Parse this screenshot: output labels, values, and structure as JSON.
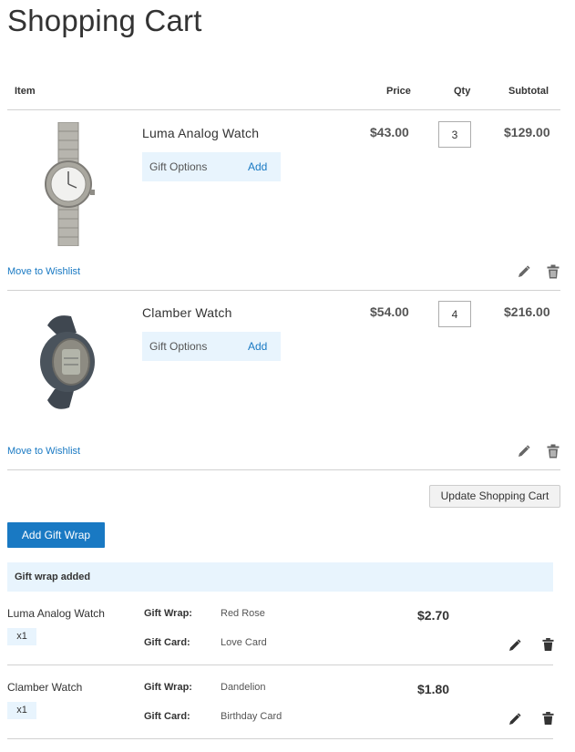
{
  "page": {
    "title": "Shopping Cart"
  },
  "cart": {
    "headers": {
      "item": "Item",
      "price": "Price",
      "qty": "Qty",
      "subtotal": "Subtotal"
    },
    "items": [
      {
        "name": "Luma Analog Watch",
        "gift_options_label": "Gift Options",
        "gift_add_label": "Add",
        "price": "$43.00",
        "qty": "3",
        "subtotal": "$129.00",
        "wishlist_label": "Move to Wishlist"
      },
      {
        "name": "Clamber Watch",
        "gift_options_label": "Gift Options",
        "gift_add_label": "Add",
        "price": "$54.00",
        "qty": "4",
        "subtotal": "$216.00",
        "wishlist_label": "Move to Wishlist"
      }
    ],
    "update_button": "Update Shopping Cart"
  },
  "gift_wrap": {
    "add_button": "Add Gift Wrap",
    "banner": "Gift wrap added",
    "rows": [
      {
        "product": "Luma Analog Watch",
        "qty": "x1",
        "wrap_label": "Gift Wrap:",
        "wrap_value": "Red Rose",
        "card_label": "Gift Card:",
        "card_value": "Love Card",
        "price": "$2.70"
      },
      {
        "product": "Clamber Watch",
        "qty": "x1",
        "wrap_label": "Gift Wrap:",
        "wrap_value": "Dandelion",
        "card_label": "Gift Card:",
        "card_value": "Birthday Card",
        "price": "$1.80"
      }
    ]
  },
  "icons": {
    "edit": "pencil-icon",
    "delete": "trash-icon"
  },
  "colors": {
    "link": "#1979c3",
    "primary_button": "#1979c3",
    "highlight_bg": "#e8f4fd",
    "divider": "#d1d1d1"
  }
}
